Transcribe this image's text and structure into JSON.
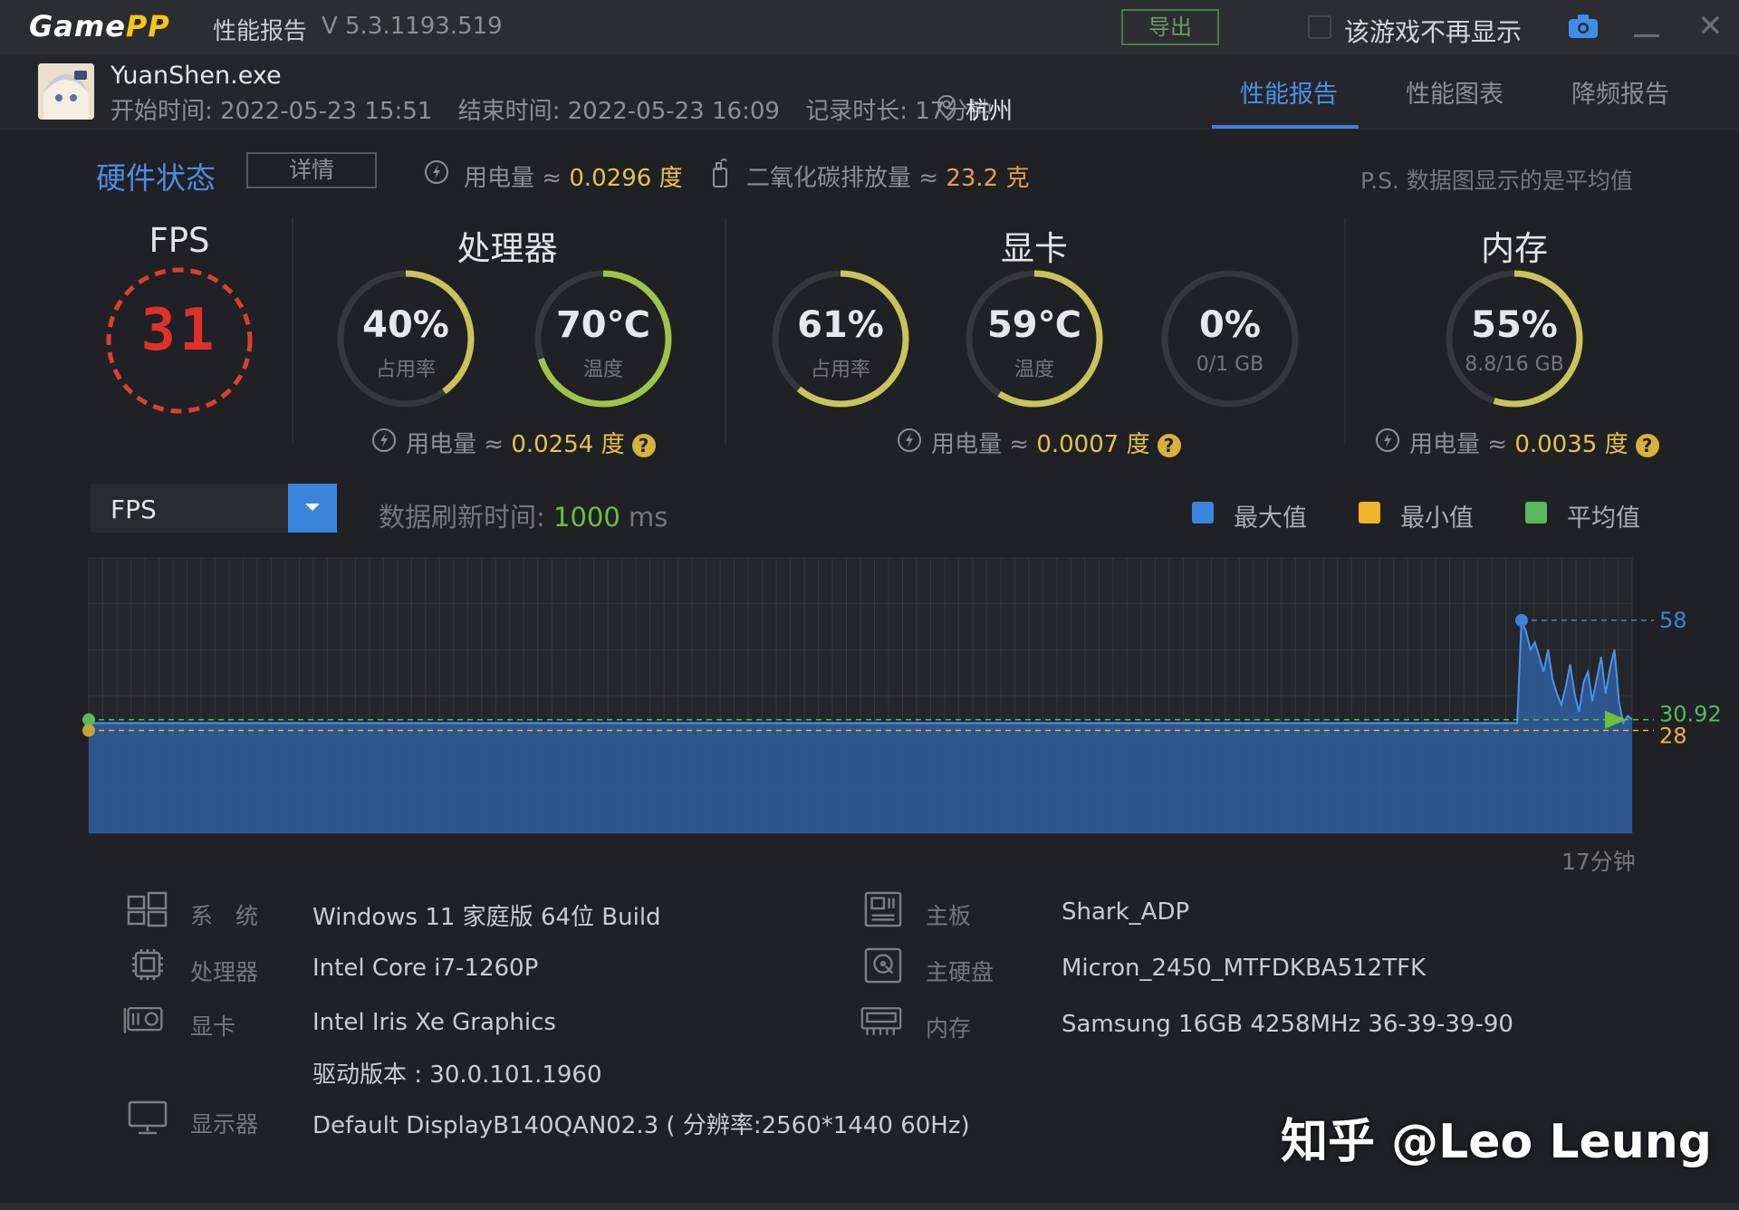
{
  "titlebar": {
    "logo_a": "Game",
    "logo_b": "PP",
    "title": "性能报告",
    "version": "V 5.3.1193.519",
    "export_label": "导出",
    "noshow_label": "该游戏不再显示"
  },
  "header": {
    "process": "YuanShen.exe",
    "start": "开始时间: 2022-05-23 15:51",
    "end": "结束时间: 2022-05-23 16:09",
    "duration": "记录时长: 17分钟",
    "location": "杭州",
    "tabs": [
      "性能报告",
      "性能图表",
      "降频报告"
    ]
  },
  "hardware": {
    "title": "硬件状态",
    "detail_label": "详情",
    "power_label": "用电量 ≈ ",
    "power_value": "0.0296 度",
    "co2_label": "二氧化碳排放量 ≈ ",
    "co2_value": "23.2 克",
    "note": "P.S. 数据图显示的是平均值"
  },
  "sections": {
    "fps": {
      "title": "FPS",
      "value": "31"
    },
    "cpu": {
      "title": "处理器",
      "usage": "40%",
      "usage_label": "占用率",
      "usage_frac": 0.4,
      "temp": "70℃",
      "temp_label": "温度",
      "temp_frac": 0.7,
      "power_label": "用电量 ≈ ",
      "power_value": "0.0254 度"
    },
    "gpu": {
      "title": "显卡",
      "usage": "61%",
      "usage_label": "占用率",
      "usage_frac": 0.61,
      "temp": "59℃",
      "temp_label": "温度",
      "temp_frac": 0.59,
      "vram": "0%",
      "vram_label": "0/1 GB",
      "vram_frac": 0.0,
      "power_label": "用电量 ≈ ",
      "power_value": "0.0007 度"
    },
    "mem": {
      "title": "内存",
      "usage": "55%",
      "usage_label": "8.8/16 GB",
      "usage_frac": 0.55,
      "power_label": "用电量 ≈ ",
      "power_value": "0.0035 度"
    }
  },
  "chart_controls": {
    "metric": "FPS",
    "refresh_label": "数据刷新时间: ",
    "refresh_value": "1000",
    "refresh_unit": " ms",
    "legend": [
      {
        "label": "最大值",
        "color": "#3b84dc"
      },
      {
        "label": "最小值",
        "color": "#f0b429"
      },
      {
        "label": "平均值",
        "color": "#5cb85c"
      }
    ]
  },
  "chart_data": {
    "type": "area",
    "ylim": [
      0,
      75
    ],
    "max_label": "58",
    "avg_label": "30.92",
    "min_label": "28",
    "max": 58,
    "avg": 30.92,
    "min": 28,
    "x_end_label": "17分钟",
    "values": [
      31,
      30,
      30,
      30,
      30,
      30,
      30,
      30,
      30,
      30,
      30,
      30,
      30,
      30,
      30,
      30,
      30,
      30,
      30,
      30,
      30,
      30,
      30,
      30,
      30,
      30,
      30,
      30,
      30,
      30,
      30,
      30,
      30,
      30,
      30,
      30,
      30,
      30,
      30,
      30,
      30,
      30,
      30,
      30,
      30,
      30,
      30,
      30,
      30,
      30,
      30,
      30,
      30,
      30,
      30,
      30,
      30,
      30,
      30,
      30,
      30,
      30,
      30,
      30,
      30,
      30,
      30,
      30,
      30,
      30,
      30,
      30,
      30,
      30,
      30,
      30,
      30,
      30,
      30,
      30,
      30,
      30,
      30,
      30,
      30,
      30,
      30,
      30,
      30,
      30,
      30,
      30,
      30,
      30,
      30,
      30,
      30,
      30,
      30,
      30,
      30,
      30,
      30,
      30,
      30,
      30,
      30,
      30,
      30,
      30,
      30,
      30,
      30,
      30,
      30,
      30,
      30,
      30,
      30,
      30,
      30,
      30,
      30,
      30,
      30,
      30,
      30,
      30,
      30,
      30,
      30,
      30,
      30,
      30,
      30,
      30,
      30,
      30,
      30,
      30,
      30,
      30,
      30,
      30,
      30,
      30,
      30,
      30,
      30,
      30,
      30,
      30,
      30,
      30,
      30,
      30,
      30,
      30,
      30,
      30,
      30,
      30,
      30,
      30,
      30,
      30,
      30,
      30,
      30,
      30,
      30,
      30,
      30,
      30,
      30,
      30,
      30,
      30,
      30,
      30,
      30,
      30,
      30,
      30,
      30,
      30,
      30,
      30,
      30,
      30,
      30,
      30,
      30,
      30,
      30,
      30,
      30,
      30,
      30,
      30,
      30,
      30,
      30,
      30,
      30,
      30,
      30,
      30,
      30,
      30,
      30,
      30,
      30,
      30,
      30,
      30,
      30,
      30,
      30,
      30,
      30,
      30,
      30,
      30,
      30,
      30,
      30,
      30,
      30,
      30,
      30,
      30,
      30,
      30,
      30,
      30,
      30,
      30,
      30,
      30,
      30,
      30,
      30,
      30,
      30,
      30,
      30,
      30,
      30,
      30,
      30,
      30,
      30,
      30,
      30,
      30,
      30,
      30,
      30,
      30,
      30,
      30,
      30,
      30,
      30,
      30,
      30,
      30,
      30,
      30,
      30,
      30,
      30,
      30,
      30,
      30,
      30,
      30,
      30,
      30,
      30,
      30,
      30,
      30,
      30,
      30,
      30,
      30,
      30,
      30,
      30,
      30,
      30,
      30,
      30,
      30,
      30,
      30,
      30,
      30,
      30,
      30,
      30,
      30,
      30,
      30,
      30,
      30,
      30,
      30,
      30,
      30,
      30,
      30,
      30,
      30,
      30,
      30,
      30,
      30,
      30,
      30,
      30,
      30,
      58,
      55,
      50,
      52,
      48,
      44,
      50,
      42,
      38,
      35,
      40,
      46,
      38,
      33,
      41,
      44,
      36,
      42,
      48,
      38,
      45,
      50,
      36,
      30,
      32,
      31
    ]
  },
  "system": {
    "os_key": "系　统",
    "os_val": "Windows 11 家庭版 64位   Build",
    "cpu_key": "处理器",
    "cpu_val": "Intel Core i7-1260P",
    "gpu_key": "显卡",
    "gpu_val": "Intel Iris Xe Graphics",
    "driver_val": "驱动版本 : 30.0.101.1960",
    "monitor_key": "显示器",
    "monitor_val": "Default DisplayB140QAN02.3 ( 分辨率:2560*1440 60Hz)",
    "board_key": "主板",
    "board_val": "Shark_ADP",
    "disk_key": "主硬盘",
    "disk_val": "Micron_2450_MTFDKBA512TFK",
    "ram_key": "内存",
    "ram_val": "Samsung 16GB 4258MHz 36-39-39-90"
  },
  "watermark": "知乎 @Leo Leung"
}
